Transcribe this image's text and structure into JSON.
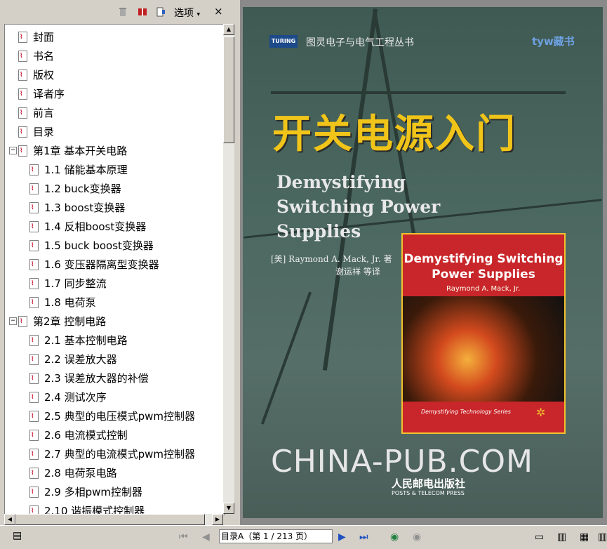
{
  "toolbar": {
    "options_label": "选项",
    "close_label": "×"
  },
  "bookmarks": [
    {
      "label": "封面",
      "level": 0
    },
    {
      "label": "书名",
      "level": 0
    },
    {
      "label": "版权",
      "level": 0
    },
    {
      "label": "译者序",
      "level": 0
    },
    {
      "label": "前言",
      "level": 0
    },
    {
      "label": "目录",
      "level": 0
    },
    {
      "label": "第1章  基本开关电路",
      "level": 0,
      "expanded": true
    },
    {
      "label": "1.1  储能基本原理",
      "level": 1
    },
    {
      "label": "1.2  buck变换器",
      "level": 1
    },
    {
      "label": "1.3  boost变换器",
      "level": 1
    },
    {
      "label": "1.4  反相boost变换器",
      "level": 1
    },
    {
      "label": "1.5  buck boost变换器",
      "level": 1
    },
    {
      "label": "1.6  变压器隔离型变换器",
      "level": 1
    },
    {
      "label": "1.7  同步整流",
      "level": 1
    },
    {
      "label": "1.8  电荷泵",
      "level": 1
    },
    {
      "label": "第2章  控制电路",
      "level": 0,
      "expanded": true
    },
    {
      "label": "2.1  基本控制电路",
      "level": 1
    },
    {
      "label": "2.2  误差放大器",
      "level": 1
    },
    {
      "label": "2.3  误差放大器的补偿",
      "level": 1
    },
    {
      "label": "2.4  测试次序",
      "level": 1
    },
    {
      "label": "2.5  典型的电压模式pwm控制器",
      "level": 1
    },
    {
      "label": "2.6  电流模式控制",
      "level": 1
    },
    {
      "label": "2.7  典型的电流模式pwm控制器",
      "level": 1
    },
    {
      "label": "2.8  电荷泵电路",
      "level": 1
    },
    {
      "label": "2.9  多相pwm控制器",
      "level": 1
    },
    {
      "label": "2.10  谐振模式控制器",
      "level": 1
    }
  ],
  "cover": {
    "publisher_logo": "TURING",
    "series": "图灵电子与电气工程丛书",
    "watermark": "tyw藏书",
    "title_cn": "开关电源入门",
    "title_en_lines": [
      "Demystifying",
      "Switching Power",
      "Supplies"
    ],
    "author": "[美] Raymond A. Mack, Jr. 著",
    "translator": "谢运祥  等译",
    "inner_title_lines": [
      "Demystifying Switching",
      "Power Supplies"
    ],
    "inner_author": "Raymond A. Mack, Jr.",
    "inner_series": "Demystifying Technology Series",
    "website": "CHINA-PUB.COM",
    "publisher_cn": "人民邮电出版社",
    "publisher_en": "POSTS & TELECOM PRESS"
  },
  "status": {
    "page_field": "目录A（第 1 / 213 页）"
  },
  "icons": {
    "trash": "trash-icon",
    "book": "book-icon",
    "bookmark": "bookmark-icon",
    "pdf_page": "pdf-page-icon",
    "first_page": "first-page-icon",
    "prev_page": "prev-page-icon",
    "next_page": "next-page-icon",
    "last_page": "last-page-icon",
    "back": "back-icon",
    "forward": "forward-icon"
  }
}
